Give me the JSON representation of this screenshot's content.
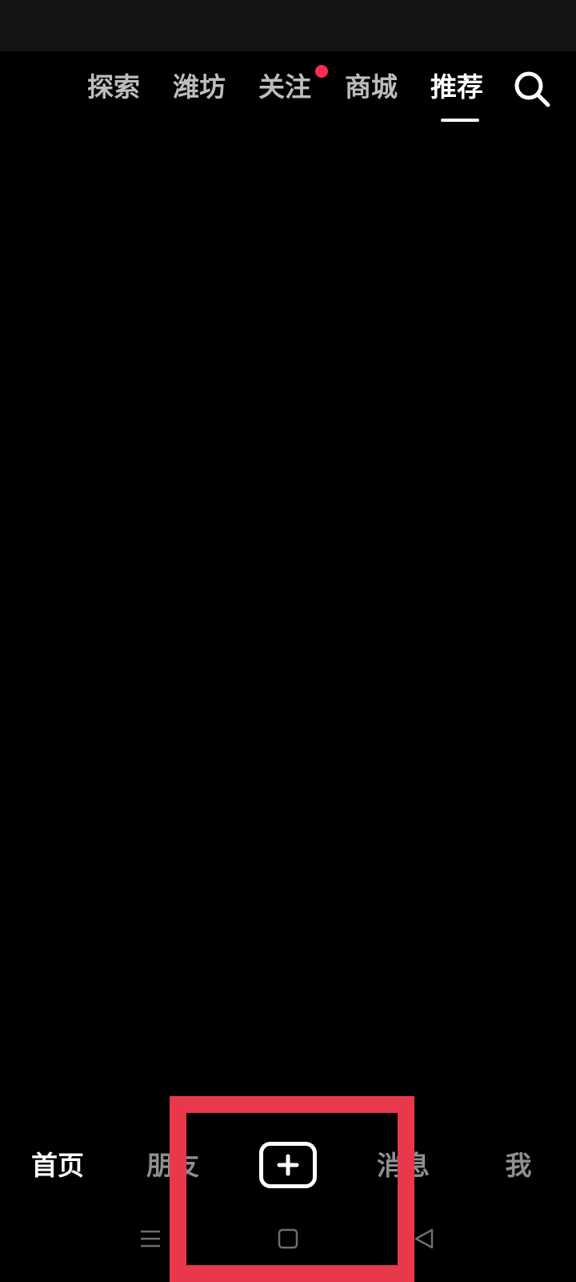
{
  "top_nav": {
    "tabs": [
      {
        "label": "探索",
        "active": false
      },
      {
        "label": "潍坊",
        "active": false
      },
      {
        "label": "关注",
        "active": false,
        "badge": "red-dot"
      },
      {
        "label": "商城",
        "active": false
      },
      {
        "label": "推荐",
        "active": true
      }
    ],
    "search_icon": "search-icon"
  },
  "bottom_nav": {
    "tabs": [
      {
        "label": "首页",
        "active": true
      },
      {
        "label": "朋友",
        "active": false
      },
      {
        "label": "消息",
        "active": false
      },
      {
        "label": "我",
        "active": false
      }
    ],
    "create_icon": "plus-square-icon"
  },
  "system_nav": {
    "icons": [
      "menu-icon",
      "home-square-icon",
      "back-triangle-icon"
    ]
  },
  "colors": {
    "background": "#000000",
    "status_bar": "#141414",
    "active_text": "#ffffff",
    "inactive_top_text": "#bdbdbd",
    "inactive_bottom_text": "#8f8f8f",
    "badge_red": "#fe2c55",
    "highlight_red": "#e9384b"
  }
}
